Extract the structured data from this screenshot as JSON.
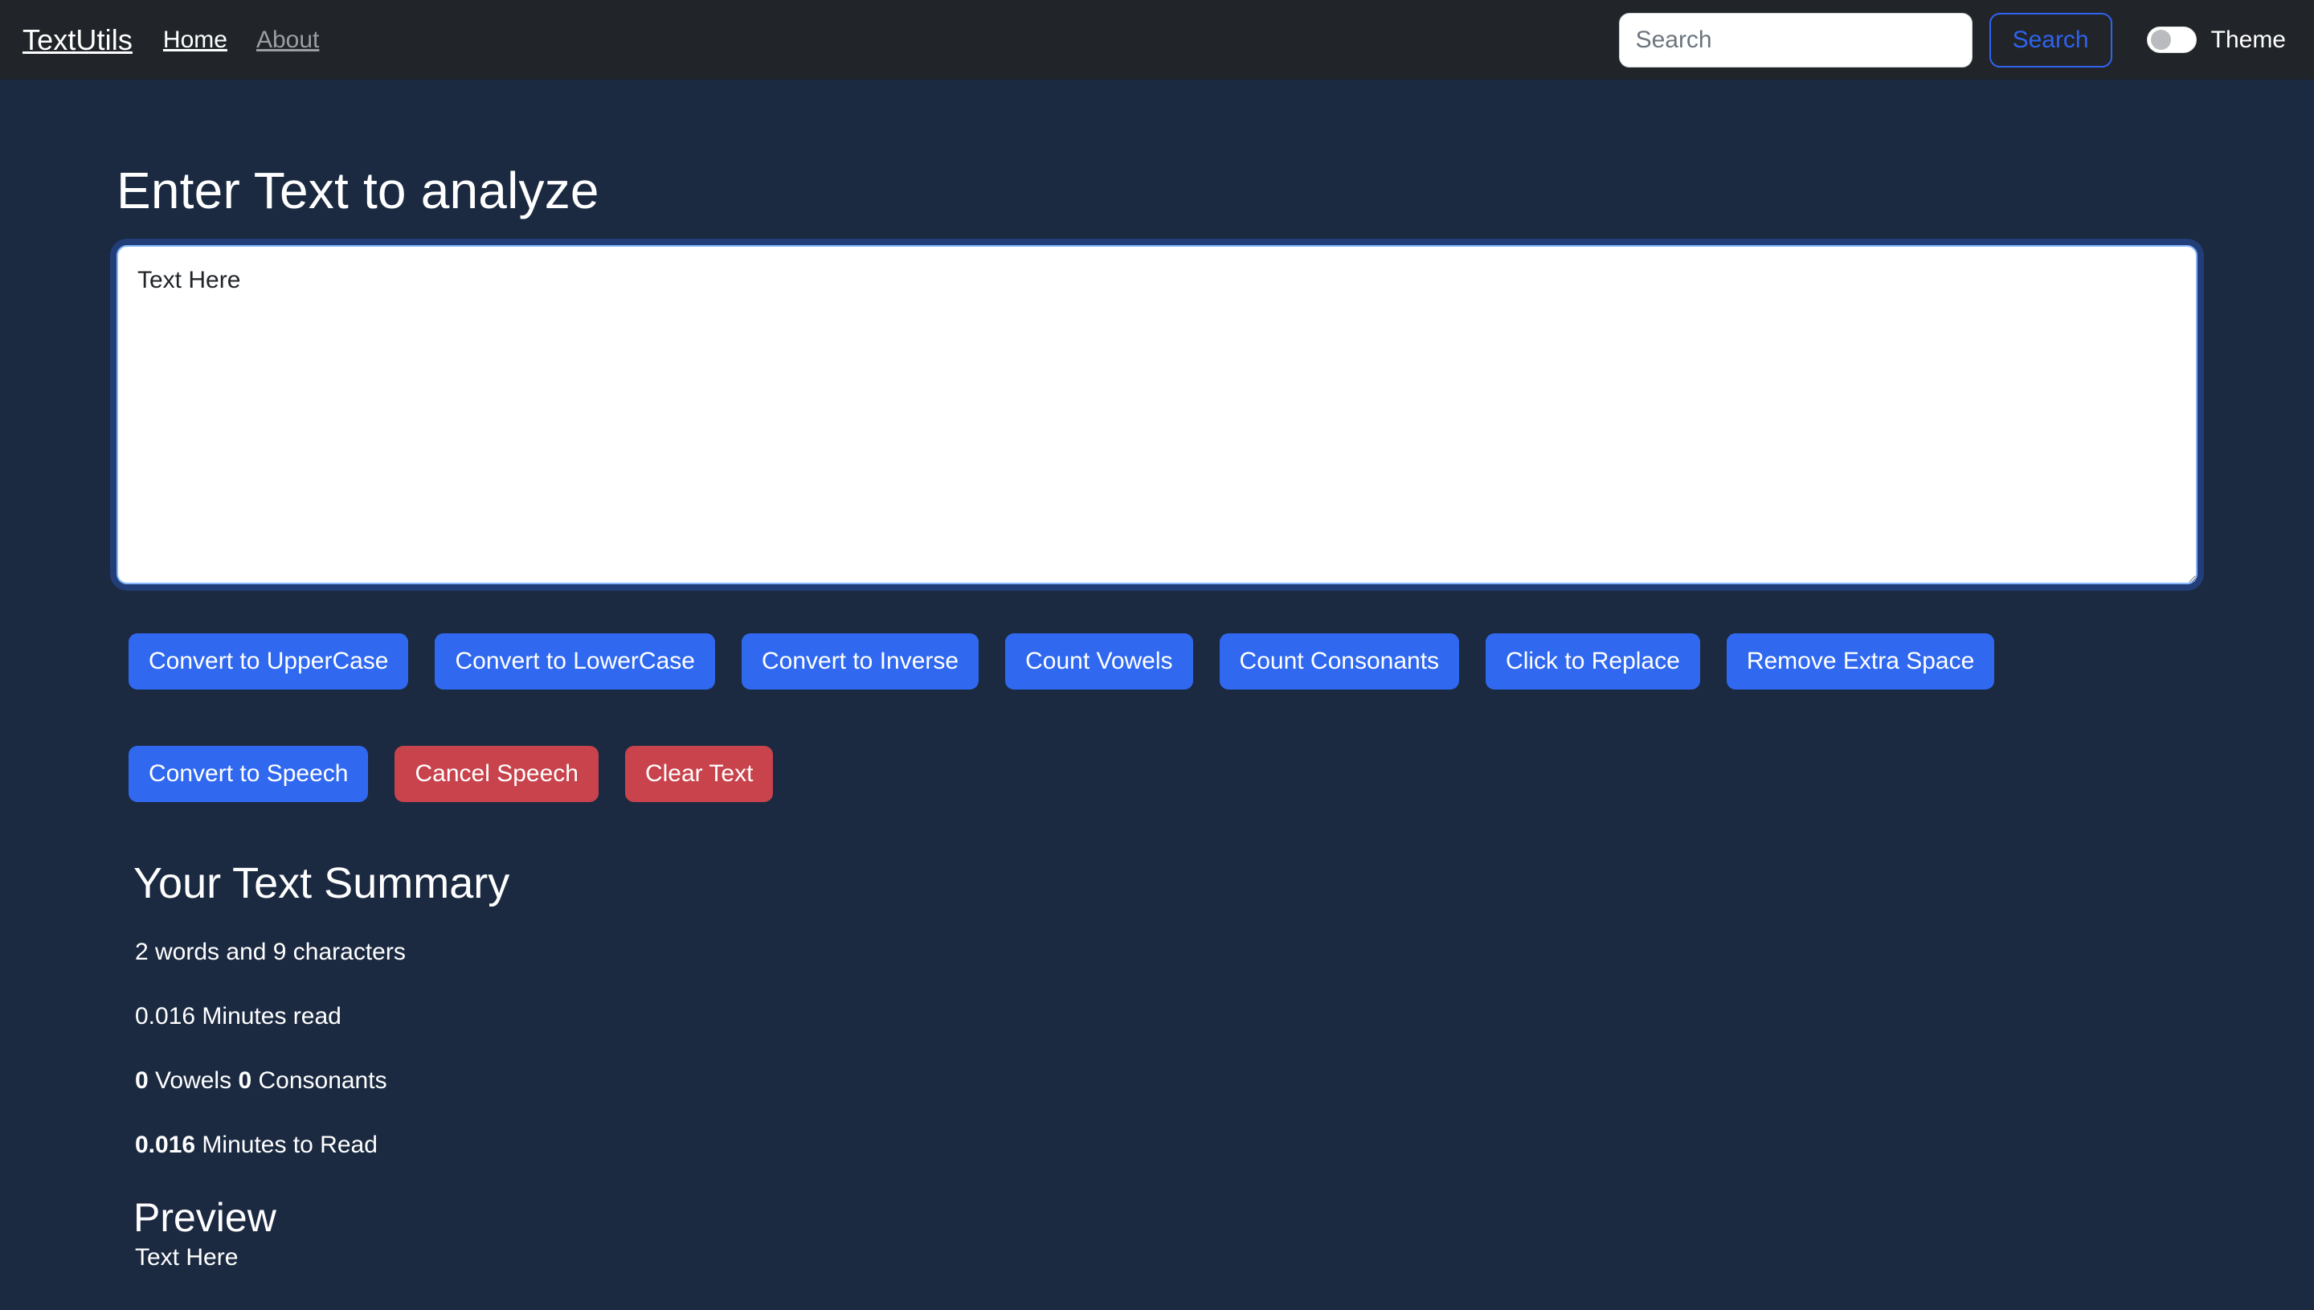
{
  "navbar": {
    "brand": "TextUtils",
    "links": [
      {
        "label": "Home",
        "active": true
      },
      {
        "label": "About",
        "active": false
      }
    ],
    "search": {
      "placeholder": "Search",
      "value": "",
      "button_label": "Search"
    },
    "theme": {
      "label": "Theme",
      "enabled": false
    },
    "colors": {
      "background": "#212529",
      "accent": "#2f63f0"
    }
  },
  "main": {
    "heading": "Enter Text to analyze",
    "textarea": {
      "value": "Text Here",
      "placeholder": ""
    },
    "buttons_row1": [
      {
        "label": "Convert to UpperCase",
        "variant": "primary"
      },
      {
        "label": "Convert to LowerCase",
        "variant": "primary"
      },
      {
        "label": "Convert to Inverse",
        "variant": "primary"
      },
      {
        "label": "Count Vowels",
        "variant": "primary"
      },
      {
        "label": "Count Consonants",
        "variant": "primary"
      },
      {
        "label": "Click to Replace",
        "variant": "primary"
      },
      {
        "label": "Remove Extra Space",
        "variant": "primary"
      }
    ],
    "buttons_row2": [
      {
        "label": "Convert to Speech",
        "variant": "primary"
      },
      {
        "label": "Cancel Speech",
        "variant": "danger"
      },
      {
        "label": "Clear Text",
        "variant": "danger"
      }
    ],
    "summary": {
      "title": "Your Text Summary",
      "words_and_characters": "2 words and 9 characters",
      "minutes_read": "0.016 Minutes read",
      "vowels_count": "0",
      "vowels_label": "Vowels",
      "consonants_count": "0",
      "consonants_label": "Consonants",
      "minutes_to_read_value": "0.016",
      "minutes_to_read_label": "Minutes to Read"
    },
    "preview": {
      "title": "Preview",
      "text": "Text Here"
    }
  },
  "colors": {
    "page_background": "#1b2a41",
    "primary": "#3069f0",
    "danger": "#c8434c",
    "text": "#ffffff"
  }
}
